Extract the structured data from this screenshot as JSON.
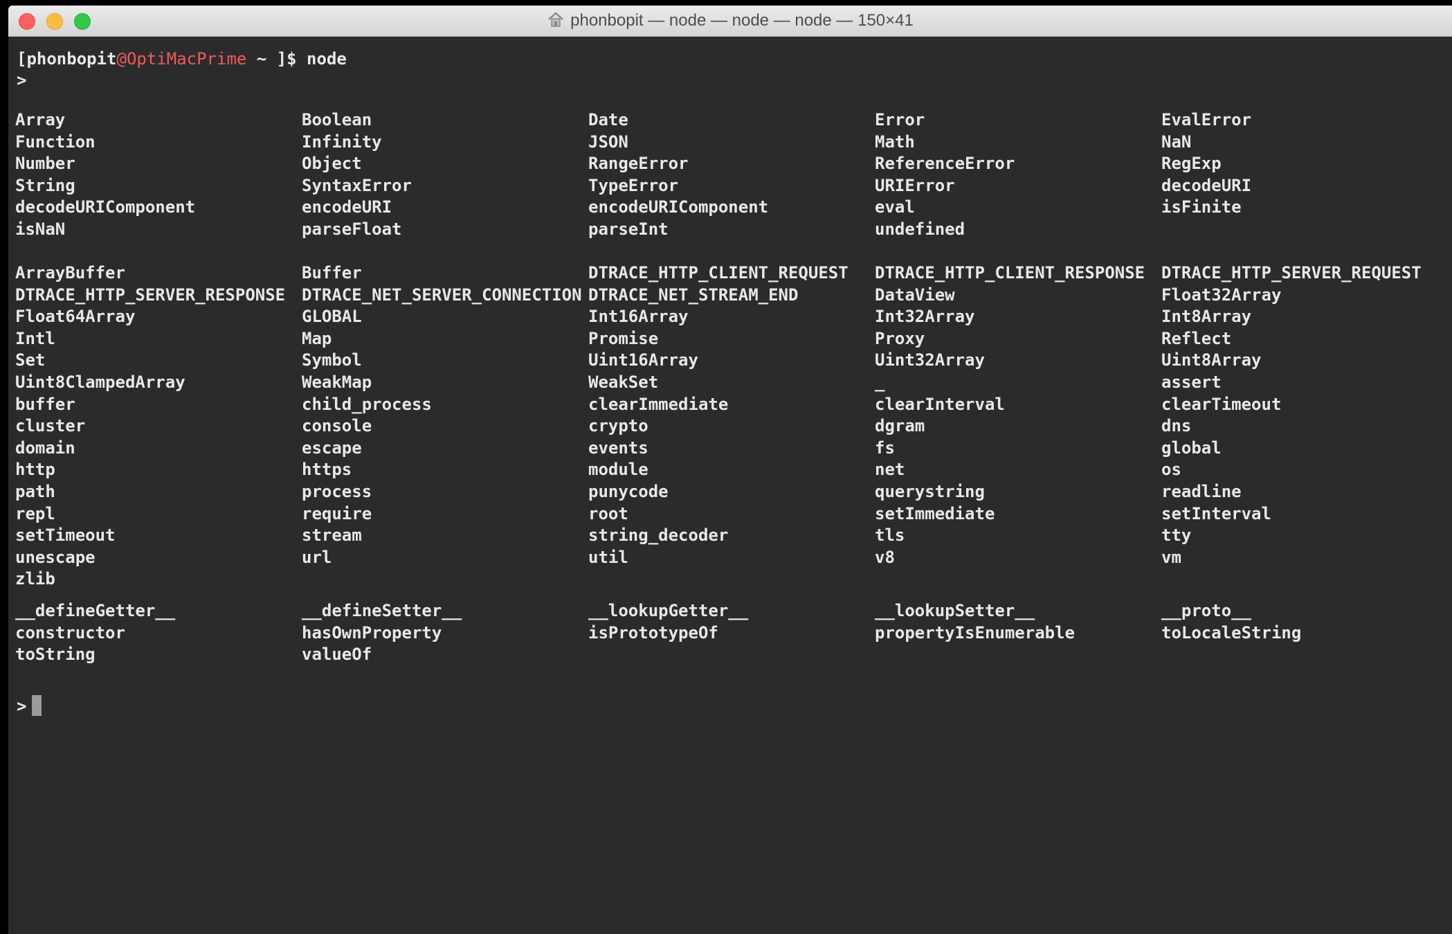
{
  "window": {
    "title": "phonbopit — node — node — node — 150×41"
  },
  "terminal": {
    "prompt": {
      "open": "[",
      "user": "phonbopit",
      "at": "@",
      "host": "OptiMacPrime",
      "path_and_command": " ~ ]$ node"
    },
    "repl_prompt": ">",
    "blocks": [
      [
        [
          "Array",
          "Boolean",
          "Date",
          "Error",
          "EvalError"
        ],
        [
          "Function",
          "Infinity",
          "JSON",
          "Math",
          "NaN"
        ],
        [
          "Number",
          "Object",
          "RangeError",
          "ReferenceError",
          "RegExp"
        ],
        [
          "String",
          "SyntaxError",
          "TypeError",
          "URIError",
          "decodeURI"
        ],
        [
          "decodeURIComponent",
          "encodeURI",
          "encodeURIComponent",
          "eval",
          "isFinite"
        ],
        [
          "isNaN",
          "parseFloat",
          "parseInt",
          "undefined",
          ""
        ]
      ],
      [
        [
          "ArrayBuffer",
          "Buffer",
          "DTRACE_HTTP_CLIENT_REQUEST",
          "DTRACE_HTTP_CLIENT_RESPONSE",
          "DTRACE_HTTP_SERVER_REQUEST"
        ],
        [
          "DTRACE_HTTP_SERVER_RESPONSE",
          "DTRACE_NET_SERVER_CONNECTION",
          "DTRACE_NET_STREAM_END",
          "DataView",
          "Float32Array"
        ],
        [
          "Float64Array",
          "GLOBAL",
          "Int16Array",
          "Int32Array",
          "Int8Array"
        ],
        [
          "Intl",
          "Map",
          "Promise",
          "Proxy",
          "Reflect"
        ],
        [
          "Set",
          "Symbol",
          "Uint16Array",
          "Uint32Array",
          "Uint8Array"
        ],
        [
          "Uint8ClampedArray",
          "WeakMap",
          "WeakSet",
          "_",
          "assert"
        ],
        [
          "buffer",
          "child_process",
          "clearImmediate",
          "clearInterval",
          "clearTimeout"
        ],
        [
          "cluster",
          "console",
          "crypto",
          "dgram",
          "dns"
        ],
        [
          "domain",
          "escape",
          "events",
          "fs",
          "global"
        ],
        [
          "http",
          "https",
          "module",
          "net",
          "os"
        ],
        [
          "path",
          "process",
          "punycode",
          "querystring",
          "readline"
        ],
        [
          "repl",
          "require",
          "root",
          "setImmediate",
          "setInterval"
        ],
        [
          "setTimeout",
          "stream",
          "string_decoder",
          "tls",
          "tty"
        ],
        [
          "unescape",
          "url",
          "util",
          "v8",
          "vm"
        ],
        [
          "zlib",
          "",
          "",
          "",
          ""
        ]
      ],
      [
        [
          "__defineGetter__",
          "__defineSetter__",
          "__lookupGetter__",
          "__lookupSetter__",
          "__proto__"
        ],
        [
          "constructor",
          "hasOwnProperty",
          "isPrototypeOf",
          "propertyIsEnumerable",
          "toLocaleString"
        ],
        [
          "toString",
          "valueOf",
          "",
          "",
          ""
        ]
      ]
    ],
    "final_prompt": ">"
  },
  "colors": {
    "background": "#2b2b2b",
    "text": "#e8e8e8",
    "host": "#f25a5a",
    "cursor": "#9a9a9a"
  }
}
